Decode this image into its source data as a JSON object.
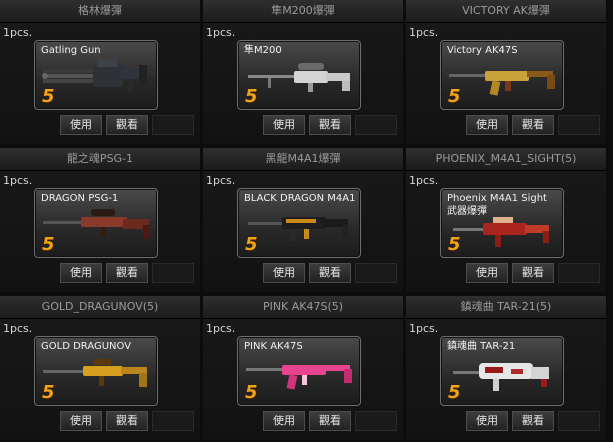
{
  "items": [
    {
      "title": "格林爆彈",
      "qty": "1pcs.",
      "name": "Gatling Gun",
      "level": "5",
      "use_label": "使用",
      "view_label": "觀看",
      "icon": "gatling-gun-icon",
      "colors": {
        "body": "#3a3f46",
        "accent": "#8a8f95"
      }
    },
    {
      "title": "隼M200爆彈",
      "qty": "1pcs.",
      "name": "隼M200",
      "level": "5",
      "use_label": "使用",
      "view_label": "觀看",
      "icon": "m200-sniper-icon",
      "colors": {
        "body": "#d9d9d9",
        "accent": "#6a6a6a"
      }
    },
    {
      "title": "VICTORY AK爆彈",
      "qty": "1pcs.",
      "name": "Victory AK47S",
      "level": "5",
      "use_label": "使用",
      "view_label": "觀看",
      "icon": "victory-ak47s-icon",
      "colors": {
        "body": "#c9a23a",
        "accent": "#7a3a1a"
      }
    },
    {
      "title": "龍之魂PSG-1",
      "qty": "1pcs.",
      "name": "DRAGON PSG-1",
      "level": "5",
      "use_label": "使用",
      "view_label": "觀看",
      "icon": "dragon-psg1-icon",
      "colors": {
        "body": "#8a3a2a",
        "accent": "#2a1a14"
      }
    },
    {
      "title": "黑龍M4A1爆彈",
      "qty": "1pcs.",
      "name": "BLACK DRAGON M4A1",
      "level": "5",
      "use_label": "使用",
      "view_label": "觀看",
      "icon": "black-dragon-m4a1-icon",
      "colors": {
        "body": "#1e1e1e",
        "accent": "#c98a1a"
      }
    },
    {
      "title": "PHOENIX_M4A1_SIGHT(5)",
      "qty": "1pcs.",
      "name": "Phoenix  M4A1 Sight\n武器爆彈",
      "level": "5",
      "use_label": "使用",
      "view_label": "觀看",
      "icon": "phoenix-m4a1-icon",
      "colors": {
        "body": "#a8261e",
        "accent": "#e0b08a"
      }
    },
    {
      "title": "GOLD_DRAGUNOV(5)",
      "qty": "1pcs.",
      "name": "GOLD DRAGUNOV",
      "level": "5",
      "use_label": "使用",
      "view_label": "觀看",
      "icon": "gold-dragunov-icon",
      "colors": {
        "body": "#d6a01e",
        "accent": "#5a3a0c"
      }
    },
    {
      "title": "PINK AK47S(5)",
      "qty": "1pcs.",
      "name": "PINK  AK47S",
      "level": "5",
      "use_label": "使用",
      "view_label": "觀看",
      "icon": "pink-ak47s-icon",
      "colors": {
        "body": "#e8438f",
        "accent": "#f7c4dc"
      }
    },
    {
      "title": "鎮魂曲 TAR-21(5)",
      "qty": "1pcs.",
      "name": "鎮魂曲  TAR-21",
      "level": "5",
      "use_label": "使用",
      "view_label": "觀看",
      "icon": "requiem-tar21-icon",
      "colors": {
        "body": "#e6e6e6",
        "accent": "#9a1a1a"
      }
    }
  ]
}
